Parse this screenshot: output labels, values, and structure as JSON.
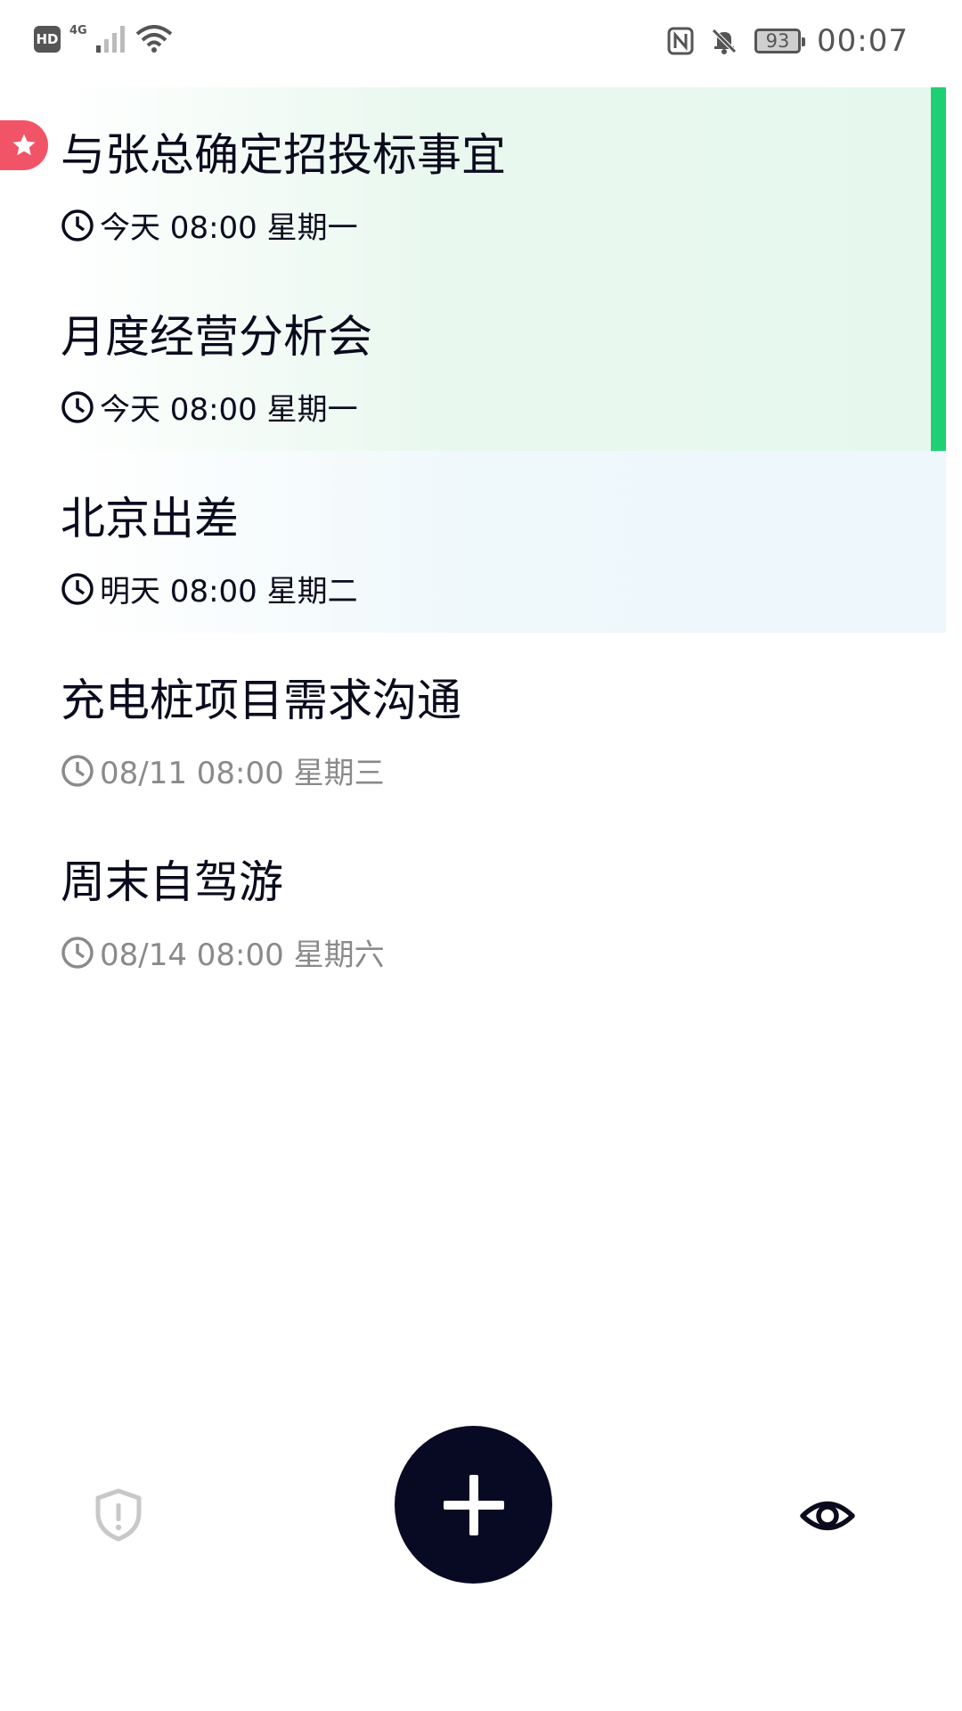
{
  "status_bar": {
    "hd_label": "HD",
    "network": "4G",
    "battery": "93",
    "time": "00:07"
  },
  "reminders": [
    {
      "title": "与张总确定招投标事宜",
      "time": "今天 08:00 星期一",
      "starred": true
    },
    {
      "title": "月度经营分析会",
      "time": "今天 08:00 星期一",
      "starred": false
    },
    {
      "title": "北京出差",
      "time": "明天 08:00 星期二",
      "starred": false
    },
    {
      "title": "充电桩项目需求沟通",
      "time": "08/11 08:00 星期三",
      "starred": false
    },
    {
      "title": "周末自驾游",
      "time": "08/14 08:00 星期六",
      "starred": false
    }
  ],
  "colors": {
    "accent_green": "#1fd072",
    "star_red": "#f25467",
    "fab_dark": "#070a22",
    "muted_text": "#8a8a8a"
  },
  "icons": {
    "left_nav": "shield-alert-icon",
    "center": "plus-icon",
    "right_nav": "eye-icon"
  }
}
